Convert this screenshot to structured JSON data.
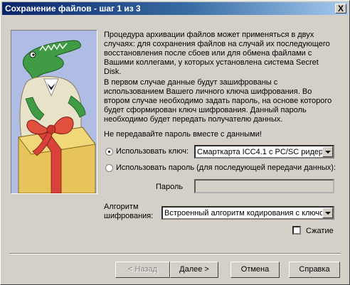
{
  "window": {
    "title": "Сохранение файлов - шаг 1 из 3",
    "close_label": "X"
  },
  "intro": {
    "p1": [
      "Процедура архивации файлов может применяться в двух",
      "случаях: для сохранения файлов на случай их последующего",
      "восстановления после сбоев или для обмена файлами с",
      "Вашими коллегами, у которых установлена система Secret",
      "Disk."
    ],
    "p2": [
      "В первом случае данные будут зашифрованы с",
      "использованием Вашего личного ключа шифрования. Во",
      "втором случае необходимо задать пароль, на основе которого",
      "будет сформирован ключ шифрования. Данный пароль",
      "необходимо будет передать получателю данных."
    ],
    "warning": "Не передавайте пароль вместе с данными!"
  },
  "options": {
    "use_key_label": "Использовать ключ:",
    "use_key_value": "Смарткарта ICC4.1 с PC/SC ридер",
    "use_password_label": "Использовать пароль (для последующей передачи данных):",
    "password_label": "Пароль",
    "password_value": "",
    "algorithm_label_1": "Алгоритм",
    "algorithm_label_2": "шифрования:",
    "algorithm_value": "Встроенный алгоритм кодирования с ключо",
    "compress_label": "Сжатие"
  },
  "buttons": {
    "back": "< Назад",
    "next": "Далее >",
    "cancel": "Отмена",
    "help": "Справка"
  }
}
